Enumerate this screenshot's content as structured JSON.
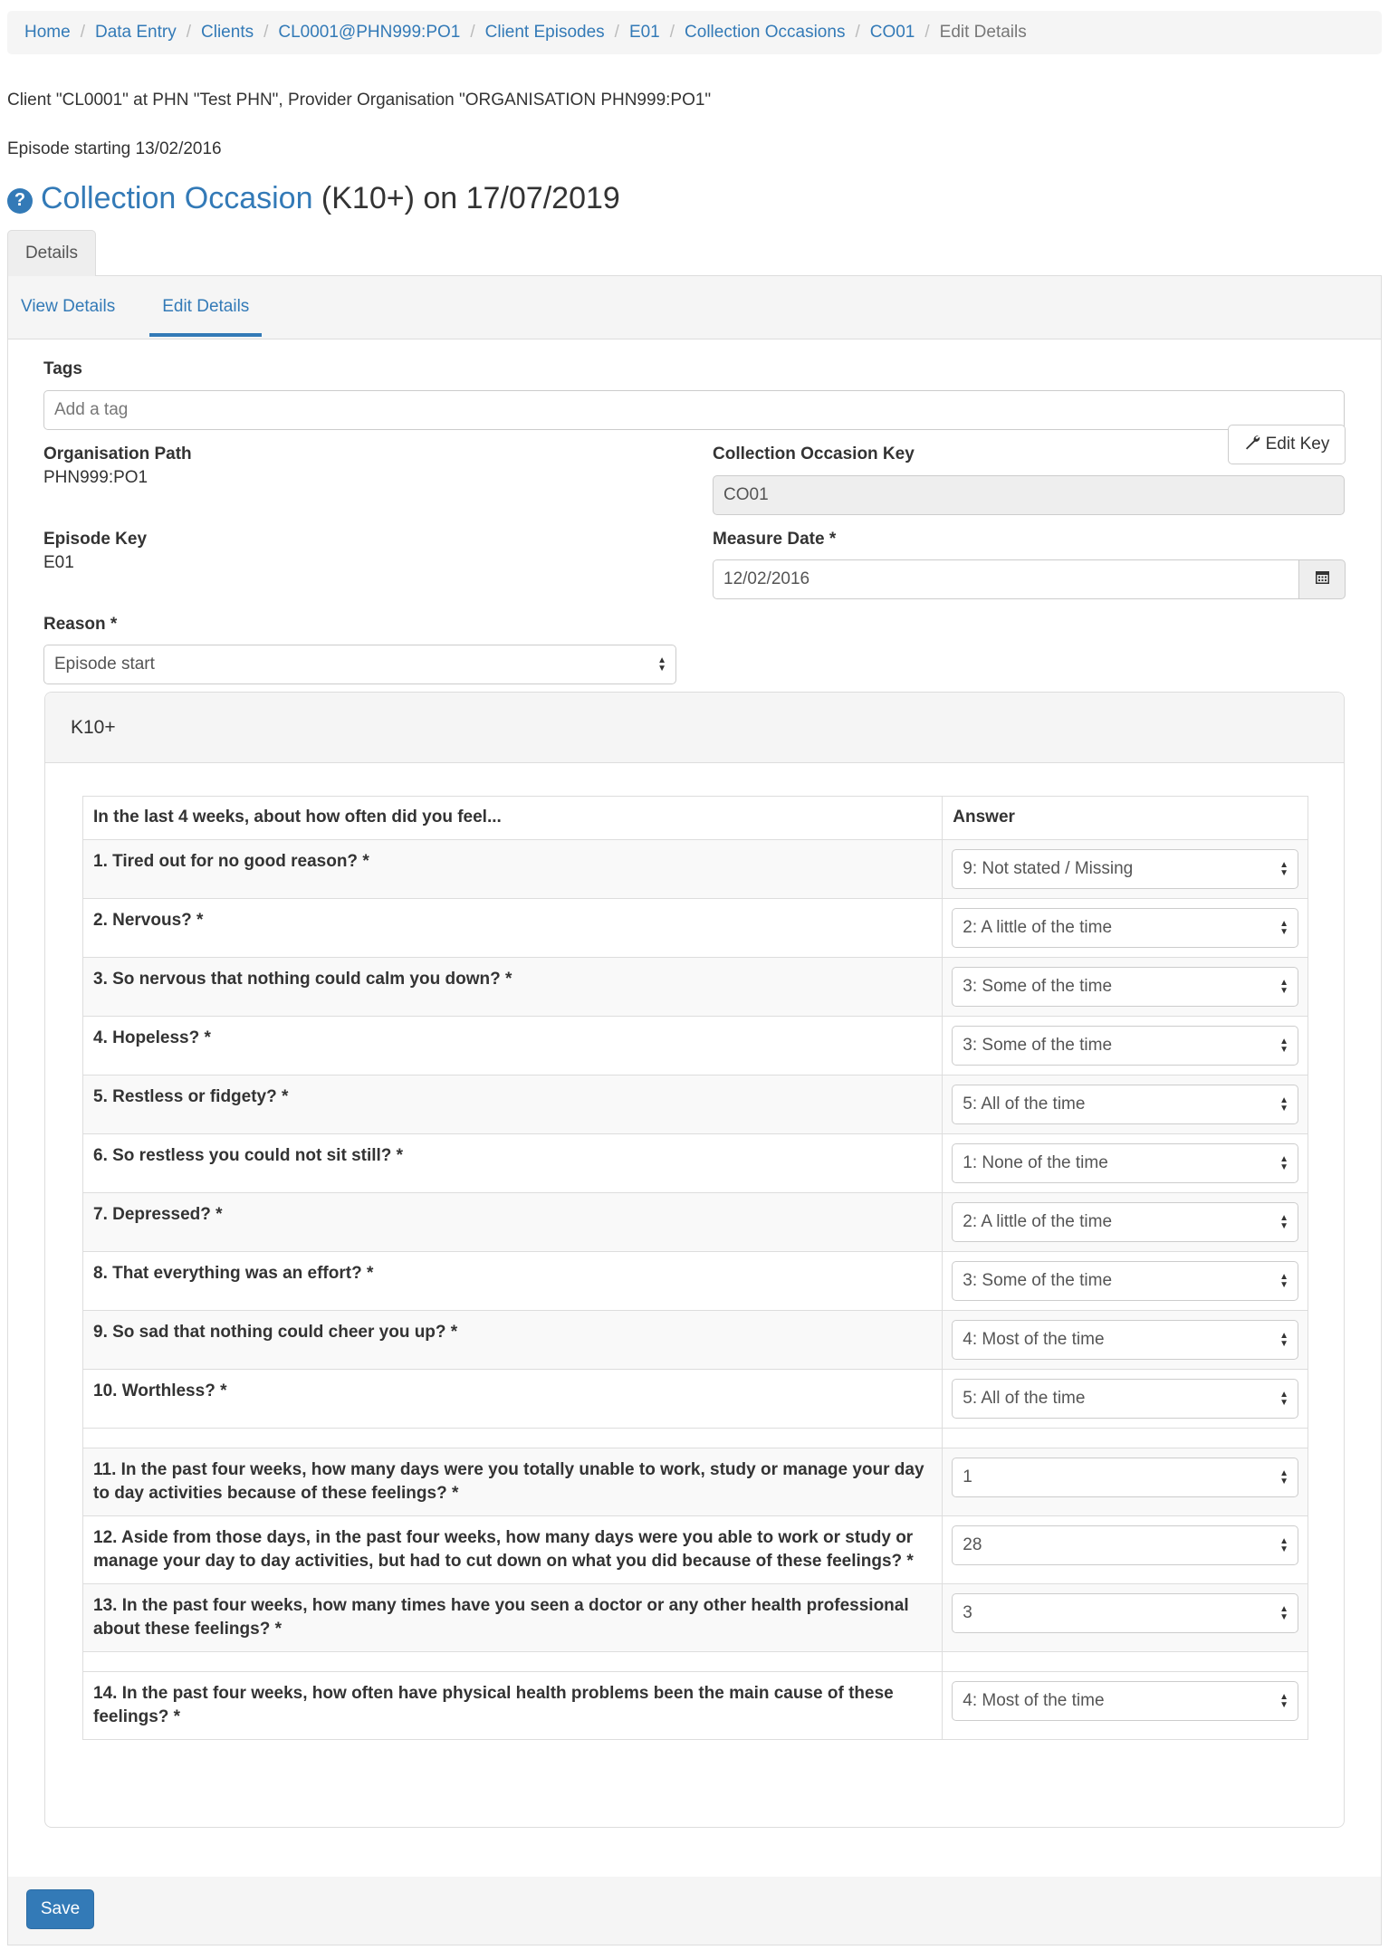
{
  "breadcrumb": {
    "items": [
      "Home",
      "Data Entry",
      "Clients",
      "CL0001@PHN999:PO1",
      "Client Episodes",
      "E01",
      "Collection Occasions",
      "CO01"
    ],
    "active": "Edit Details"
  },
  "info": {
    "client_line": "Client \"CL0001\" at PHN \"Test PHN\", Provider Organisation \"ORGANISATION PHN999:PO1\"",
    "episode_line": "Episode starting 13/02/2016"
  },
  "title": {
    "help_icon": "?",
    "link": "Collection Occasion",
    "rest": " (K10+) on 17/07/2019"
  },
  "tabs": {
    "outer": "Details",
    "view": "View Details",
    "edit": "Edit Details"
  },
  "form": {
    "tags_label": "Tags",
    "tags_placeholder": "Add a tag",
    "org_path_label": "Organisation Path",
    "org_path_value": "PHN999:PO1",
    "episode_key_label": "Episode Key",
    "episode_key_value": "E01",
    "co_key_label": "Collection Occasion Key",
    "co_key_value": "CO01",
    "edit_key_button": "Edit Key",
    "measure_date_label": "Measure Date *",
    "measure_date_value": "12/02/2016",
    "reason_label": "Reason *",
    "reason_value": "Episode start"
  },
  "k10": {
    "heading": "K10+",
    "col_question": "In the last 4 weeks, about how often did you feel...",
    "col_answer": "Answer",
    "questions_a": [
      {
        "q": "1. Tired out for no good reason? *",
        "a": "9: Not stated / Missing"
      },
      {
        "q": "2. Nervous? *",
        "a": "2: A little of the time"
      },
      {
        "q": "3. So nervous that nothing could calm you down? *",
        "a": "3: Some of the time"
      },
      {
        "q": "4. Hopeless? *",
        "a": "3: Some of the time"
      },
      {
        "q": "5. Restless or fidgety? *",
        "a": "5: All of the time"
      },
      {
        "q": "6. So restless you could not sit still? *",
        "a": "1: None of the time"
      },
      {
        "q": "7. Depressed? *",
        "a": "2: A little of the time"
      },
      {
        "q": "8. That everything was an effort? *",
        "a": "3: Some of the time"
      },
      {
        "q": "9. So sad that nothing could cheer you up? *",
        "a": "4: Most of the time"
      },
      {
        "q": "10. Worthless? *",
        "a": "5: All of the time"
      }
    ],
    "questions_b": [
      {
        "q": "11. In the past four weeks, how many days were you totally unable to work, study or manage your day to day activities because of these feelings? *",
        "a": "1"
      },
      {
        "q": "12. Aside from those days, in the past four weeks, how many days were you able to work or study or manage your day to day activities, but had to cut down on what you did because of these feelings? *",
        "a": "28"
      },
      {
        "q": "13. In the past four weeks, how many times have you seen a doctor or any other health professional about these feelings? *",
        "a": "3"
      }
    ],
    "questions_c": [
      {
        "q": "14. In the past four weeks, how often have physical health problems been the main cause of these feelings? *",
        "a": "4: Most of the time"
      }
    ]
  },
  "footer": {
    "save": "Save"
  }
}
